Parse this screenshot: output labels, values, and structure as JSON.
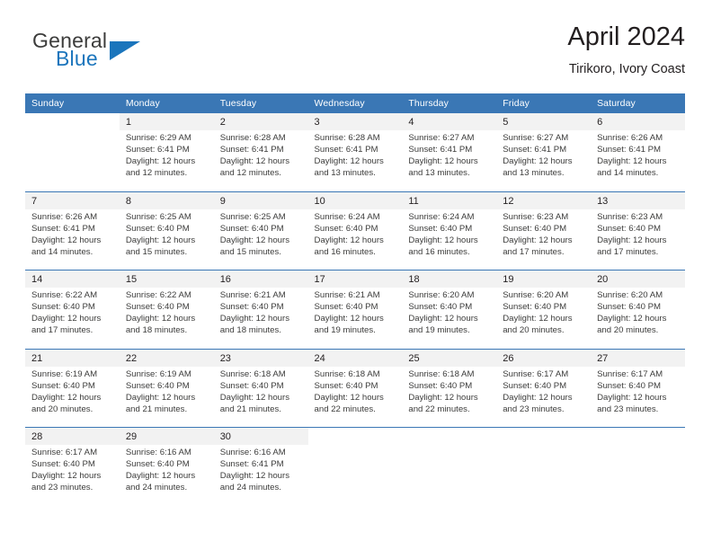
{
  "logo": {
    "word_top": "General",
    "word_bottom": "Blue",
    "accent_color": "#1b75bc"
  },
  "header": {
    "title": "April 2024",
    "subtitle": "Tirikoro, Ivory Coast"
  },
  "calendar": {
    "header_bg": "#3a77b5",
    "daynum_bg": "#f2f2f2",
    "weekdays": [
      "Sunday",
      "Monday",
      "Tuesday",
      "Wednesday",
      "Thursday",
      "Friday",
      "Saturday"
    ],
    "weeks": [
      [
        {
          "day": "",
          "sunrise": "",
          "sunset": "",
          "daylight_1": "",
          "daylight_2": ""
        },
        {
          "day": "1",
          "sunrise": "Sunrise: 6:29 AM",
          "sunset": "Sunset: 6:41 PM",
          "daylight_1": "Daylight: 12 hours",
          "daylight_2": "and 12 minutes."
        },
        {
          "day": "2",
          "sunrise": "Sunrise: 6:28 AM",
          "sunset": "Sunset: 6:41 PM",
          "daylight_1": "Daylight: 12 hours",
          "daylight_2": "and 12 minutes."
        },
        {
          "day": "3",
          "sunrise": "Sunrise: 6:28 AM",
          "sunset": "Sunset: 6:41 PM",
          "daylight_1": "Daylight: 12 hours",
          "daylight_2": "and 13 minutes."
        },
        {
          "day": "4",
          "sunrise": "Sunrise: 6:27 AM",
          "sunset": "Sunset: 6:41 PM",
          "daylight_1": "Daylight: 12 hours",
          "daylight_2": "and 13 minutes."
        },
        {
          "day": "5",
          "sunrise": "Sunrise: 6:27 AM",
          "sunset": "Sunset: 6:41 PM",
          "daylight_1": "Daylight: 12 hours",
          "daylight_2": "and 13 minutes."
        },
        {
          "day": "6",
          "sunrise": "Sunrise: 6:26 AM",
          "sunset": "Sunset: 6:41 PM",
          "daylight_1": "Daylight: 12 hours",
          "daylight_2": "and 14 minutes."
        }
      ],
      [
        {
          "day": "7",
          "sunrise": "Sunrise: 6:26 AM",
          "sunset": "Sunset: 6:41 PM",
          "daylight_1": "Daylight: 12 hours",
          "daylight_2": "and 14 minutes."
        },
        {
          "day": "8",
          "sunrise": "Sunrise: 6:25 AM",
          "sunset": "Sunset: 6:40 PM",
          "daylight_1": "Daylight: 12 hours",
          "daylight_2": "and 15 minutes."
        },
        {
          "day": "9",
          "sunrise": "Sunrise: 6:25 AM",
          "sunset": "Sunset: 6:40 PM",
          "daylight_1": "Daylight: 12 hours",
          "daylight_2": "and 15 minutes."
        },
        {
          "day": "10",
          "sunrise": "Sunrise: 6:24 AM",
          "sunset": "Sunset: 6:40 PM",
          "daylight_1": "Daylight: 12 hours",
          "daylight_2": "and 16 minutes."
        },
        {
          "day": "11",
          "sunrise": "Sunrise: 6:24 AM",
          "sunset": "Sunset: 6:40 PM",
          "daylight_1": "Daylight: 12 hours",
          "daylight_2": "and 16 minutes."
        },
        {
          "day": "12",
          "sunrise": "Sunrise: 6:23 AM",
          "sunset": "Sunset: 6:40 PM",
          "daylight_1": "Daylight: 12 hours",
          "daylight_2": "and 17 minutes."
        },
        {
          "day": "13",
          "sunrise": "Sunrise: 6:23 AM",
          "sunset": "Sunset: 6:40 PM",
          "daylight_1": "Daylight: 12 hours",
          "daylight_2": "and 17 minutes."
        }
      ],
      [
        {
          "day": "14",
          "sunrise": "Sunrise: 6:22 AM",
          "sunset": "Sunset: 6:40 PM",
          "daylight_1": "Daylight: 12 hours",
          "daylight_2": "and 17 minutes."
        },
        {
          "day": "15",
          "sunrise": "Sunrise: 6:22 AM",
          "sunset": "Sunset: 6:40 PM",
          "daylight_1": "Daylight: 12 hours",
          "daylight_2": "and 18 minutes."
        },
        {
          "day": "16",
          "sunrise": "Sunrise: 6:21 AM",
          "sunset": "Sunset: 6:40 PM",
          "daylight_1": "Daylight: 12 hours",
          "daylight_2": "and 18 minutes."
        },
        {
          "day": "17",
          "sunrise": "Sunrise: 6:21 AM",
          "sunset": "Sunset: 6:40 PM",
          "daylight_1": "Daylight: 12 hours",
          "daylight_2": "and 19 minutes."
        },
        {
          "day": "18",
          "sunrise": "Sunrise: 6:20 AM",
          "sunset": "Sunset: 6:40 PM",
          "daylight_1": "Daylight: 12 hours",
          "daylight_2": "and 19 minutes."
        },
        {
          "day": "19",
          "sunrise": "Sunrise: 6:20 AM",
          "sunset": "Sunset: 6:40 PM",
          "daylight_1": "Daylight: 12 hours",
          "daylight_2": "and 20 minutes."
        },
        {
          "day": "20",
          "sunrise": "Sunrise: 6:20 AM",
          "sunset": "Sunset: 6:40 PM",
          "daylight_1": "Daylight: 12 hours",
          "daylight_2": "and 20 minutes."
        }
      ],
      [
        {
          "day": "21",
          "sunrise": "Sunrise: 6:19 AM",
          "sunset": "Sunset: 6:40 PM",
          "daylight_1": "Daylight: 12 hours",
          "daylight_2": "and 20 minutes."
        },
        {
          "day": "22",
          "sunrise": "Sunrise: 6:19 AM",
          "sunset": "Sunset: 6:40 PM",
          "daylight_1": "Daylight: 12 hours",
          "daylight_2": "and 21 minutes."
        },
        {
          "day": "23",
          "sunrise": "Sunrise: 6:18 AM",
          "sunset": "Sunset: 6:40 PM",
          "daylight_1": "Daylight: 12 hours",
          "daylight_2": "and 21 minutes."
        },
        {
          "day": "24",
          "sunrise": "Sunrise: 6:18 AM",
          "sunset": "Sunset: 6:40 PM",
          "daylight_1": "Daylight: 12 hours",
          "daylight_2": "and 22 minutes."
        },
        {
          "day": "25",
          "sunrise": "Sunrise: 6:18 AM",
          "sunset": "Sunset: 6:40 PM",
          "daylight_1": "Daylight: 12 hours",
          "daylight_2": "and 22 minutes."
        },
        {
          "day": "26",
          "sunrise": "Sunrise: 6:17 AM",
          "sunset": "Sunset: 6:40 PM",
          "daylight_1": "Daylight: 12 hours",
          "daylight_2": "and 23 minutes."
        },
        {
          "day": "27",
          "sunrise": "Sunrise: 6:17 AM",
          "sunset": "Sunset: 6:40 PM",
          "daylight_1": "Daylight: 12 hours",
          "daylight_2": "and 23 minutes."
        }
      ],
      [
        {
          "day": "28",
          "sunrise": "Sunrise: 6:17 AM",
          "sunset": "Sunset: 6:40 PM",
          "daylight_1": "Daylight: 12 hours",
          "daylight_2": "and 23 minutes."
        },
        {
          "day": "29",
          "sunrise": "Sunrise: 6:16 AM",
          "sunset": "Sunset: 6:40 PM",
          "daylight_1": "Daylight: 12 hours",
          "daylight_2": "and 24 minutes."
        },
        {
          "day": "30",
          "sunrise": "Sunrise: 6:16 AM",
          "sunset": "Sunset: 6:41 PM",
          "daylight_1": "Daylight: 12 hours",
          "daylight_2": "and 24 minutes."
        },
        {
          "day": "",
          "sunrise": "",
          "sunset": "",
          "daylight_1": "",
          "daylight_2": ""
        },
        {
          "day": "",
          "sunrise": "",
          "sunset": "",
          "daylight_1": "",
          "daylight_2": ""
        },
        {
          "day": "",
          "sunrise": "",
          "sunset": "",
          "daylight_1": "",
          "daylight_2": ""
        },
        {
          "day": "",
          "sunrise": "",
          "sunset": "",
          "daylight_1": "",
          "daylight_2": ""
        }
      ]
    ]
  }
}
